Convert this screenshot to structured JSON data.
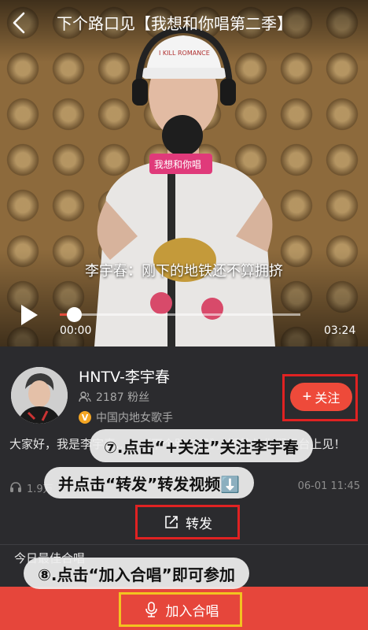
{
  "header": {
    "title": "下个路口见【我想和你唱第二季】"
  },
  "video": {
    "subtitle": "李宇春：刚下的地铁还不算拥挤",
    "current_time": "00:00",
    "total_time": "03:24",
    "progress_fraction": 0.06,
    "cap_text": "I KILL ROMANCE",
    "mic_logo_text": "我想和你唱"
  },
  "singer": {
    "name": "HNTV-李宇春",
    "fans": "2187 粉丝",
    "verified_badge": "V",
    "tag": "中国内地女歌手",
    "follow_label": "关注",
    "follow_plus": "+"
  },
  "description": {
    "text": "大家好，我是李宇春……《下个路口见》，期待与你们舞台上见！",
    "plays": "1.9万",
    "date": "06-01 11:45"
  },
  "share": {
    "label": "转发"
  },
  "best_chorus": {
    "title": "今日最佳合唱"
  },
  "annotations": {
    "step7_line1": "⑦.点击“+关注”关注李宇春",
    "step7_line2": "并点击“转发”转发视频⬇️",
    "step8": "⑧.点击“加入合唱”即可参加"
  },
  "join": {
    "label": "加入合唱"
  },
  "colors": {
    "accent_red": "#ee4a3a",
    "highlight_red": "#e02222",
    "highlight_yellow": "#f2c320",
    "panel_bg": "#2b2b2e"
  }
}
